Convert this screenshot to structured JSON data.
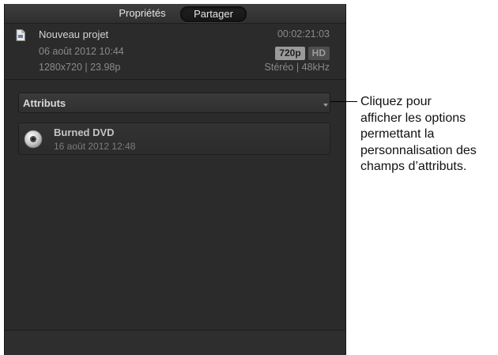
{
  "tabs": {
    "properties_label": "Propriétés",
    "share_label": "Partager"
  },
  "project": {
    "name": "Nouveau projet",
    "date": "06 août 2012 10:44",
    "format": "1280x720  |  23.98p",
    "duration": "00:02:21:03",
    "badge_resolution": "720p",
    "badge_hd": "HD",
    "audio": "Stéréo  |  48kHz"
  },
  "attributes": {
    "label": "Attributs"
  },
  "destination": {
    "name": "Burned DVD",
    "date": "16 août 2012 12:48",
    "icon": "dvd-disc-icon"
  },
  "callout": {
    "lines": [
      "Cliquez pour",
      "afficher les options",
      "permettant la",
      "personnalisation des",
      "champs d’attributs."
    ]
  },
  "colors": {
    "panel_bg": "#2b2b2b",
    "text_primary": "#d4d4d4",
    "text_secondary": "#8a8a8a"
  }
}
